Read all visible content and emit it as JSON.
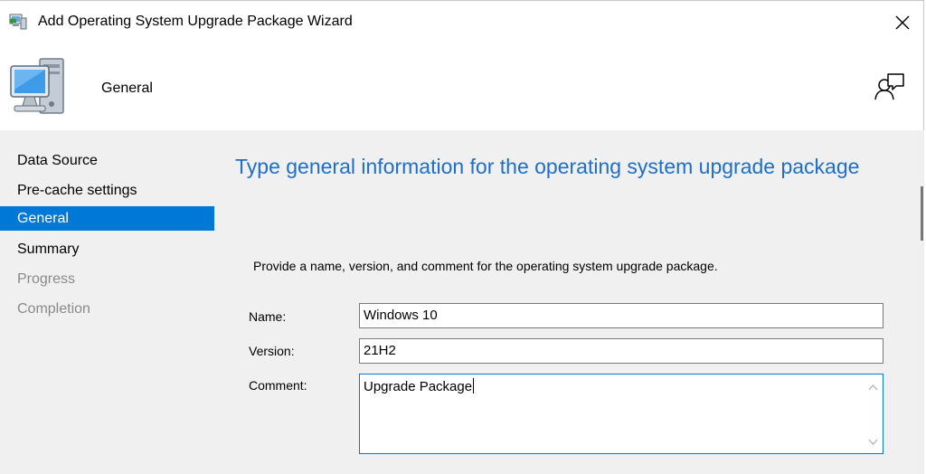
{
  "window": {
    "title": "Add Operating System Upgrade Package Wizard"
  },
  "header": {
    "title": "General",
    "icon": "computer-icon",
    "help_icon": "help-icon"
  },
  "sidebar": {
    "items": [
      {
        "label": "Data Source",
        "state": "normal"
      },
      {
        "label": "Pre-cache settings",
        "state": "normal"
      },
      {
        "label": "General",
        "state": "active"
      },
      {
        "label": "Summary",
        "state": "normal"
      },
      {
        "label": "Progress",
        "state": "disabled"
      },
      {
        "label": "Completion",
        "state": "disabled"
      }
    ]
  },
  "main": {
    "heading": "Type general information for the operating system upgrade package",
    "description": "Provide a name, version, and comment for the operating system upgrade package.",
    "fields": {
      "name_label": "Name:",
      "name_value": "Windows 10",
      "version_label": "Version:",
      "version_value": "21H2",
      "comment_label": "Comment:",
      "comment_value": "Upgrade Package"
    }
  },
  "colors": {
    "accent": "#0078d7",
    "heading": "#1e6fc8",
    "panel_bg": "#f0f0f0",
    "disabled_text": "#8a8a8a"
  }
}
